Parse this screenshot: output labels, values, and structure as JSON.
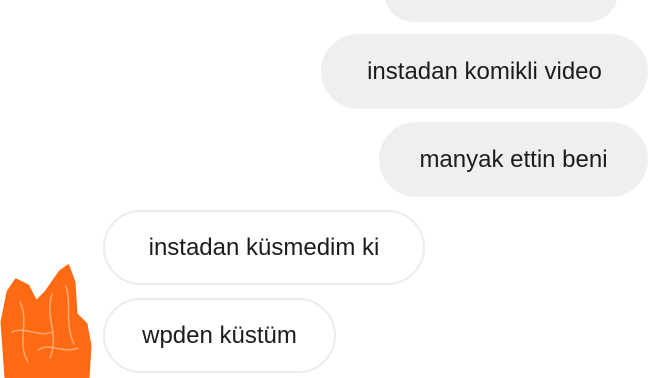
{
  "conversation": {
    "messages": [
      {
        "text": "instadan komikli video",
        "direction": "sent"
      },
      {
        "text": "manyak ettin beni",
        "direction": "sent"
      },
      {
        "text": "instadan küsmedim ki",
        "direction": "received"
      },
      {
        "text": "wpden küstüm",
        "direction": "received"
      }
    ]
  },
  "avatar": {
    "icon": "scribbled-avatar-icon",
    "color": "#ff6a13"
  },
  "colors": {
    "sent_bubble": "#efefef",
    "received_bubble": "#ffffff",
    "received_border": "#ececec",
    "text": "#1c1c1c"
  }
}
